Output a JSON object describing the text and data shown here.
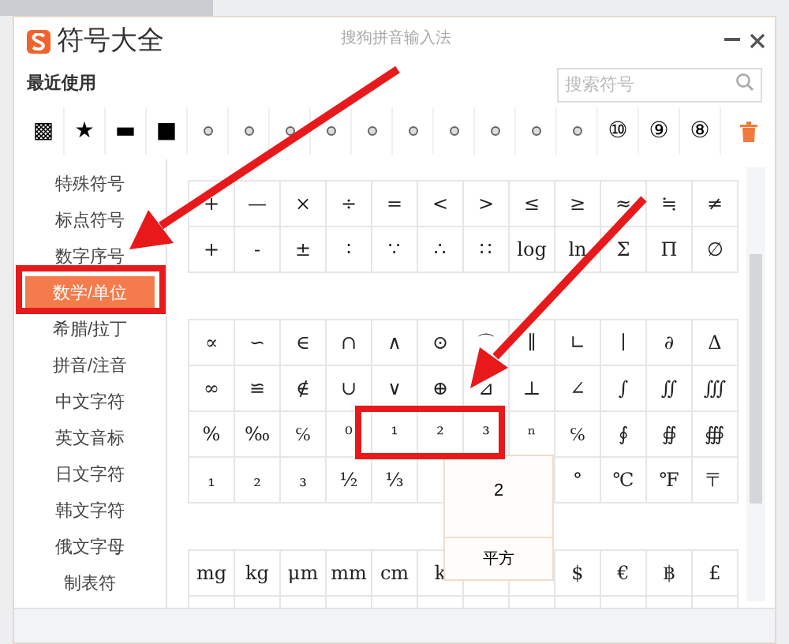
{
  "window": {
    "title": "符号大全",
    "app_name": "搜狗拼音输入法"
  },
  "recent": {
    "label": "最近使用",
    "items": [
      {
        "kind": "char",
        "text": "▩"
      },
      {
        "kind": "char",
        "text": "★"
      },
      {
        "kind": "char",
        "text": "▬"
      },
      {
        "kind": "char",
        "text": "■"
      },
      {
        "kind": "dot"
      },
      {
        "kind": "dot"
      },
      {
        "kind": "dot"
      },
      {
        "kind": "dot"
      },
      {
        "kind": "dot"
      },
      {
        "kind": "dot"
      },
      {
        "kind": "dot"
      },
      {
        "kind": "dot"
      },
      {
        "kind": "dot"
      },
      {
        "kind": "dot"
      },
      {
        "kind": "char",
        "text": "⑩"
      },
      {
        "kind": "char",
        "text": "⑨"
      },
      {
        "kind": "char",
        "text": "⑧"
      }
    ]
  },
  "search": {
    "placeholder": "搜索符号"
  },
  "categories": [
    {
      "label": "特殊符号",
      "selected": false
    },
    {
      "label": "标点符号",
      "selected": false
    },
    {
      "label": "数字序号",
      "selected": false
    },
    {
      "label": "数学/单位",
      "selected": true
    },
    {
      "label": "希腊/拉丁",
      "selected": false
    },
    {
      "label": "拼音/注音",
      "selected": false
    },
    {
      "label": "中文字符",
      "selected": false
    },
    {
      "label": "英文音标",
      "selected": false
    },
    {
      "label": "日文字符",
      "selected": false
    },
    {
      "label": "韩文字符",
      "selected": false
    },
    {
      "label": "俄文字母",
      "selected": false
    },
    {
      "label": "制表符",
      "selected": false
    }
  ],
  "symbol_groups": [
    {
      "rows": [
        [
          "+",
          "—",
          "×",
          "÷",
          "=",
          "<",
          ">",
          "≤",
          "≥",
          "≈",
          "≒",
          "≠"
        ],
        [
          "+",
          "-",
          "±",
          "∶",
          "∵",
          "∴",
          "∷",
          "log",
          "ln",
          "Σ",
          "Π",
          "∅"
        ]
      ]
    },
    {
      "rows": [
        [
          "∝",
          "∽",
          "∈",
          "∩",
          "∧",
          "⊙",
          "⌒",
          "∥",
          "∟",
          "∣",
          "∂",
          "Δ"
        ],
        [
          "∞",
          "≌",
          "∉",
          "∪",
          "∨",
          "⊕",
          "⊿",
          "⊥",
          "∠",
          "∫",
          "∬",
          "∭"
        ],
        [
          "%",
          "‰",
          "℅",
          "⁰",
          "¹",
          "²",
          "³",
          "ⁿ",
          "℅",
          "∮",
          "∯",
          "∰"
        ],
        [
          "₁",
          "₂",
          "₃",
          "½",
          "⅓",
          null,
          null,
          null,
          "°",
          "℃",
          "℉",
          "〒"
        ]
      ]
    },
    {
      "rows": [
        [
          "mg",
          "kg",
          "μm",
          "mm",
          "cm",
          "k",
          null,
          null,
          "$",
          "€",
          "฿",
          "£"
        ]
      ]
    }
  ],
  "tooltip": {
    "symbol": "2",
    "caption": "平方"
  }
}
